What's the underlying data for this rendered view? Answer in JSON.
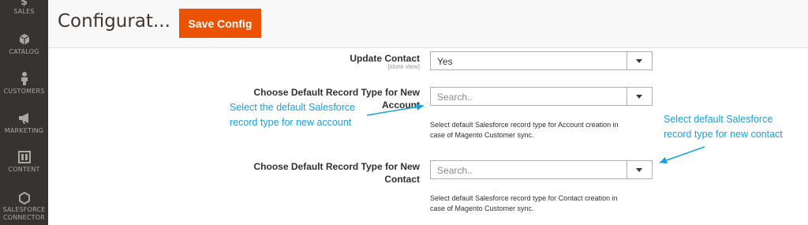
{
  "sidebar": {
    "items": [
      {
        "label": "SALES",
        "icon": "dollar-icon"
      },
      {
        "label": "CATALOG",
        "icon": "cube-icon"
      },
      {
        "label": "CUSTOMERS",
        "icon": "person-icon"
      },
      {
        "label": "MARKETING",
        "icon": "megaphone-icon"
      },
      {
        "label": "CONTENT",
        "icon": "layout-icon"
      },
      {
        "label_line1": "SALESFORCE",
        "label_line2": "CONNECTOR",
        "icon": "hexagon-icon"
      }
    ]
  },
  "header": {
    "title": "Configurat...",
    "save_label": "Save Config"
  },
  "fields": [
    {
      "label": "Update Contact",
      "scope": "[store view]",
      "value": "Yes"
    },
    {
      "label_line1": "Choose Default Record Type for New",
      "label_line2": "Account",
      "placeholder": "Search..",
      "note_line1": "Select default Salesforce record type for Account creation in",
      "note_line2": "case of Magento Customer sync."
    },
    {
      "label_line1": "Choose Default Record Type for New",
      "label_line2": "Contact",
      "placeholder": "Search..",
      "note_line1": "Select default Salesforce record type for Contact creation in",
      "note_line2": "case of Magento Customer sync."
    }
  ],
  "annotations": [
    {
      "line1": "Select the default  Salesforce",
      "line2": "record  type for new account"
    },
    {
      "line1": "Select default Salesforce",
      "line2": "record type for new contact"
    }
  ],
  "colors": {
    "accent": "#eb5202",
    "sidebar": "#373330",
    "callout": "#1a9fe0"
  }
}
